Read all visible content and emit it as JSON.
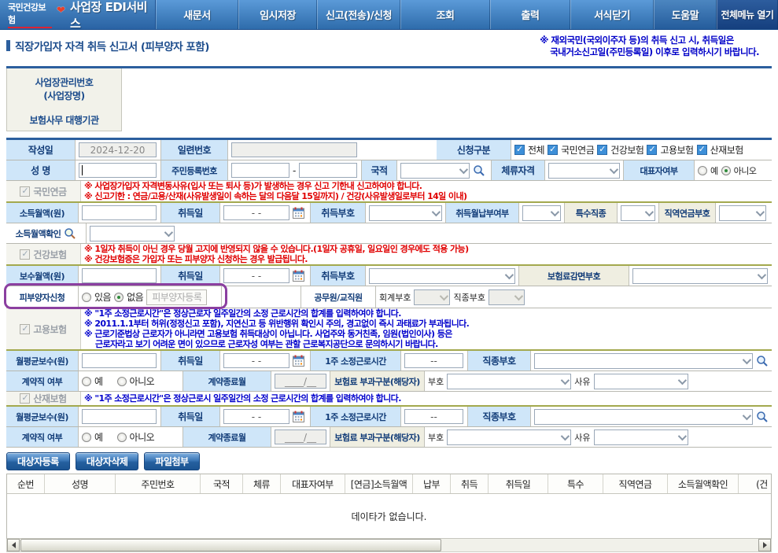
{
  "header": {
    "org_name": "국민건강보험",
    "service_title": "사업장 EDI서비스",
    "menu": [
      "새문서",
      "임시저장",
      "신고(전송)/신청",
      "조회",
      "출력",
      "서식닫기"
    ],
    "help_label": "도움말",
    "full_menu_label": "전체메뉴 열기"
  },
  "page": {
    "title": "직장가입자 자격 취득 신고서 (피부양자 포함)",
    "top_notice_line1": "※ 재외국민(국외이주자 등)의 취득 신고 시, 취득일은",
    "top_notice_line2": "국내거소신고일(주민등록일) 이후로 입력하시기 바랍니다."
  },
  "workplace": {
    "mgmt_no_label_line1": "사업장관리번호",
    "mgmt_no_label_line2": "(사업장명)",
    "agency_label": "보험사무 대행기관"
  },
  "basic": {
    "write_date_label": "작성일",
    "write_date_value": "2024-12-20",
    "serial_no_label": "일련번호",
    "apply_type_label": "신청구분",
    "apply_options": [
      "전체",
      "국민연금",
      "건강보험",
      "고용보험",
      "산재보험"
    ],
    "name_label": "성  명",
    "rrn_label": "주민등록번호",
    "nationality_label": "국적",
    "stay_status_label": "체류자격",
    "representative_label": "대표자여부",
    "yes_label": "예",
    "no_label": "아니오"
  },
  "placeholders": {
    "date": "- -",
    "month": "____/__",
    "hours": "--"
  },
  "pension": {
    "section_label": "국민연금",
    "notice1": "※ 사업장가입자 자격변동사유(입사 또는 퇴사 등)가 발생하는 경우 신고 기한내 신고하여야 합니다.",
    "notice2": "※ 신고기한 : 연금/고용/산재(사유발생일이 속하는 달의 다음달 15일까지) / 건강(사유발생일로부터 14일 이내)",
    "income_label": "소득월액(원)",
    "acq_date_label": "취득일",
    "acq_code_label": "취득부호",
    "acq_month_pay_label": "취득월납부여부",
    "special_job_label": "특수직종",
    "pension_code_label": "직역연금부호",
    "income_check_label": "소득월액확인"
  },
  "health": {
    "section_label": "건강보험",
    "notice1": "※ 1일자 취득이 아닌 경우 당월 고지에 반영되지 않을 수 있습니다.(1일자 공휴일, 일요일인 경우에도 적용 가능)",
    "notice2": "※ 건강보험증은 가입자 또는 피부양자 신청하는 경우 발급됩니다.",
    "pay_label": "보수월액(원)",
    "acq_date_label": "취득일",
    "acq_code_label": "취득부호",
    "reduction_label": "보험료감면부호",
    "dependent_label": "피부양자신청",
    "exist_label": "있음",
    "none_label": "없음",
    "dependent_reg_label": "피부양자등록",
    "official_label": "공무원/교직원",
    "account_label": "회계부호",
    "jobcode_label": "직종부호"
  },
  "employment": {
    "section_label": "고용보험",
    "notice1": "※ \"1주 소정근로시간\"은 정상근로자 일주일간의  소정 근로시간의 합계를 입력하여야 합니다.",
    "notice2": "※ 2011.1.1부터 허위(정정신고 포함), 지연신고 등 위반행위 확인시 주의, 경고없이 즉시 과태료가 부과됩니다.",
    "notice3": "※ 근로기준법상 근로자가 아니라면 고용보험 취득대상이 아닙니다. 사업주와 동거친족, 임원(법인이사) 등은",
    "notice4": "근로자라고 보기 어려운 면이 있으므로 근로자성 여부는 관할 근로복지공단으로 문의하시기 바랍니다.",
    "avg_pay_label": "월평균보수(원)",
    "acq_date_label": "취득일",
    "weekly_hours_label": "1주 소정근로시간",
    "jobcode_label": "직종부호",
    "contract_label": "계약직 여부",
    "contract_end_label": "계약종료월",
    "levy_label": "보험료 부과구분(해당자)",
    "code_label": "부호",
    "reason_label": "사유"
  },
  "accident": {
    "section_label": "산재보험",
    "notice1": "※ \"1주 소정근로시간\"은 정상근로시 일주일간의  소정 근로시간의 합계를 입력하여야 합니다.",
    "avg_pay_label": "월평균보수(원)",
    "acq_date_label": "취득일",
    "weekly_hours_label": "1주 소정근로시간",
    "jobcode_label": "직종부호",
    "contract_label": "계약직 여부",
    "contract_end_label": "계약종료월",
    "levy_label": "보험료 부과구분(해당자)",
    "code_label": "부호",
    "reason_label": "사유"
  },
  "actions": {
    "register": "대상자등록",
    "remove": "대상자삭제",
    "attach": "파일첨부"
  },
  "grid": {
    "headers": [
      "순번",
      "성명",
      "주민번호",
      "국적",
      "체류",
      "대표자여부",
      "[연금]소득월액",
      "납부",
      "취득",
      "취득일",
      "특수",
      "직역연금",
      "소득월액확인",
      "(건"
    ],
    "empty_message": "데이타가 없습니다."
  },
  "colors": {
    "topbar_blue": "#3c7fc0",
    "navy": "#1c4c8c",
    "label_blue_bg": "#cfe6f9",
    "label_beige_bg": "#efeee1",
    "notice_red": "#e00000",
    "notice_blue": "#0000cc",
    "highlight_purple": "#8b3fa0"
  }
}
